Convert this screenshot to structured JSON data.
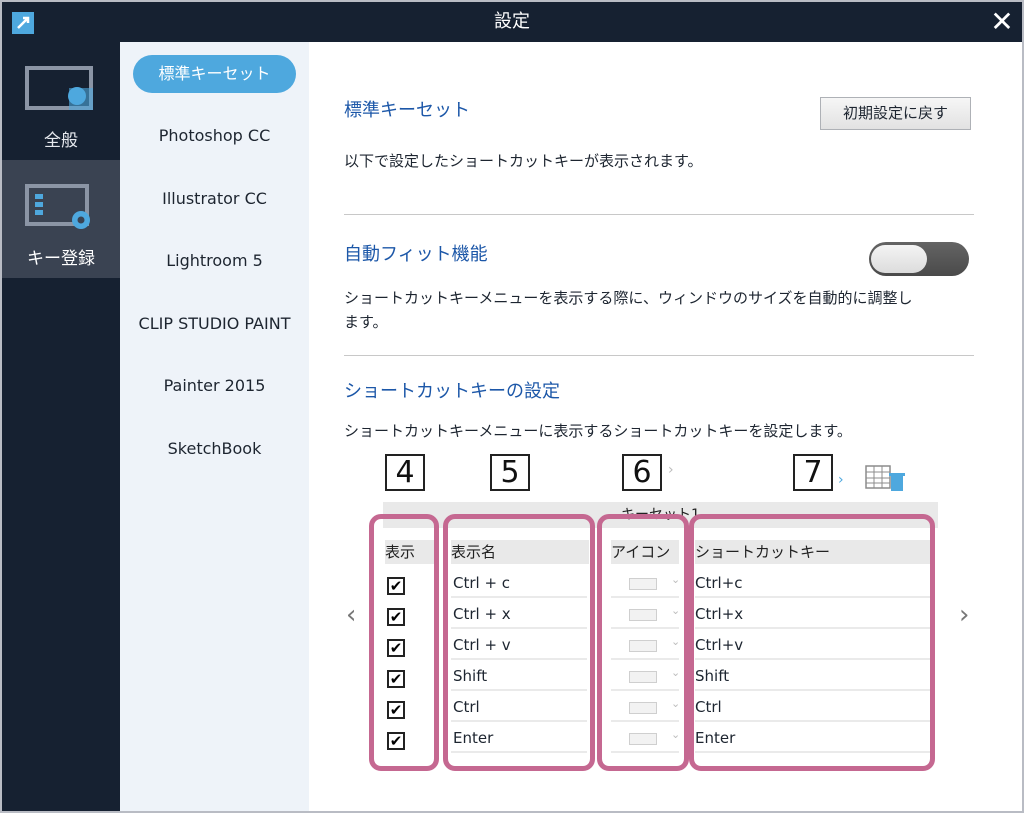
{
  "window": {
    "title": "設定"
  },
  "leftnav": [
    {
      "label": "全般"
    },
    {
      "label": "キー登録"
    }
  ],
  "presets": [
    "標準キーセット",
    "Photoshop CC",
    "Illustrator CC",
    "Lightroom 5",
    "CLIP STUDIO PAINT",
    "Painter 2015",
    "SketchBook"
  ],
  "section_standard": {
    "title": "標準キーセット",
    "reset_label": "初期設定に戻す",
    "desc": "以下で設定したショートカットキーが表示されます。"
  },
  "section_autofit": {
    "title": "自動フィット機能",
    "desc_line1": "ショートカットキーメニューを表示する際に、ウィンドウのサイズを自動的に調整し",
    "desc_line2": "ます。",
    "toggle_on": false
  },
  "section_shortcut": {
    "title": "ショートカットキーの設定",
    "desc": "ショートカットキーメニューに表示するショートカットキーを設定します。"
  },
  "callouts": [
    "4",
    "5",
    "6",
    "7"
  ],
  "table": {
    "preset_name": "キーセット1",
    "headers": {
      "show": "表示",
      "name": "表示名",
      "icon": "アイコン",
      "key": "ショートカットキー"
    },
    "rows": [
      {
        "checked": true,
        "name": "Ctrl + c",
        "key": "Ctrl+c"
      },
      {
        "checked": true,
        "name": "Ctrl + x",
        "key": "Ctrl+x"
      },
      {
        "checked": true,
        "name": "Ctrl + v",
        "key": "Ctrl+v"
      },
      {
        "checked": true,
        "name": "Shift",
        "key": "Shift"
      },
      {
        "checked": true,
        "name": "Ctrl",
        "key": "Ctrl"
      },
      {
        "checked": true,
        "name": "Enter",
        "key": "Enter"
      }
    ],
    "check_glyph": "✔"
  },
  "colors": {
    "accent": "#4ea8de",
    "titlebar": "#162131",
    "highlight": "#c56891",
    "heading": "#1c57a8"
  }
}
